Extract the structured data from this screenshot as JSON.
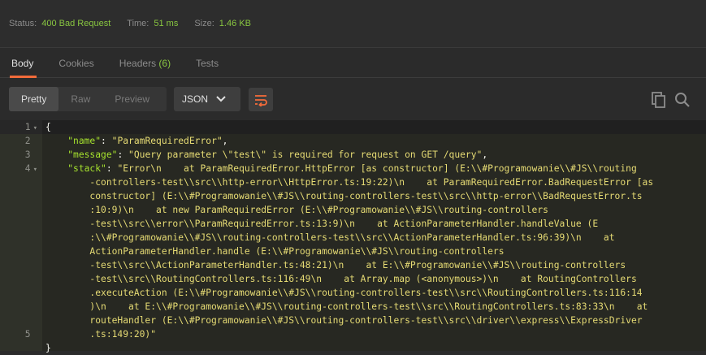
{
  "status": {
    "status_label": "Status:",
    "status_value": "400 Bad Request",
    "time_label": "Time:",
    "time_value": "51 ms",
    "size_label": "Size:",
    "size_value": "1.46 KB"
  },
  "tabs": {
    "body": "Body",
    "cookies": "Cookies",
    "headers": "Headers",
    "headers_count": "(6)",
    "tests": "Tests"
  },
  "toolbar": {
    "pretty": "Pretty",
    "raw": "Raw",
    "preview": "Preview",
    "format": "JSON"
  },
  "editor": {
    "line_numbers": [
      "1",
      "2",
      "3",
      "4",
      "",
      "",
      "",
      "",
      "",
      "",
      "",
      "",
      "",
      "",
      "",
      "5"
    ],
    "lines": [
      {
        "parts": [
          {
            "t": "{",
            "c": "plain"
          }
        ]
      },
      {
        "parts": [
          {
            "t": "    ",
            "c": "plain"
          },
          {
            "t": "\"name\"",
            "c": "key"
          },
          {
            "t": ": ",
            "c": "plain"
          },
          {
            "t": "\"ParamRequiredError\"",
            "c": "str"
          },
          {
            "t": ",",
            "c": "plain"
          }
        ]
      },
      {
        "parts": [
          {
            "t": "    ",
            "c": "plain"
          },
          {
            "t": "\"message\"",
            "c": "key"
          },
          {
            "t": ": ",
            "c": "plain"
          },
          {
            "t": "\"Query parameter \\\"test\\\" is required for request on GET /query\"",
            "c": "str"
          },
          {
            "t": ",",
            "c": "plain"
          }
        ]
      },
      {
        "parts": [
          {
            "t": "    ",
            "c": "plain"
          },
          {
            "t": "\"stack\"",
            "c": "key"
          },
          {
            "t": ": ",
            "c": "plain"
          },
          {
            "t": "\"Error\\n    at ParamRequiredError.HttpError [as constructor] (E:\\\\#Programowanie\\\\#JS\\\\routing",
            "c": "str"
          }
        ]
      },
      {
        "parts": [
          {
            "t": "        -controllers-test\\\\src\\\\http-error\\\\HttpError.ts:19:22)\\n    at ParamRequiredError.BadRequestError [as",
            "c": "str"
          }
        ]
      },
      {
        "parts": [
          {
            "t": "        constructor] (E:\\\\#Programowanie\\\\#JS\\\\routing-controllers-test\\\\src\\\\http-error\\\\BadRequestError.ts",
            "c": "str"
          }
        ]
      },
      {
        "parts": [
          {
            "t": "        :10:9)\\n    at new ParamRequiredError (E:\\\\#Programowanie\\\\#JS\\\\routing-controllers",
            "c": "str"
          }
        ]
      },
      {
        "parts": [
          {
            "t": "        -test\\\\src\\\\error\\\\ParamRequiredError.ts:13:9)\\n    at ActionParameterHandler.handleValue (E",
            "c": "str"
          }
        ]
      },
      {
        "parts": [
          {
            "t": "        :\\\\#Programowanie\\\\#JS\\\\routing-controllers-test\\\\src\\\\ActionParameterHandler.ts:96:39)\\n    at",
            "c": "str"
          }
        ]
      },
      {
        "parts": [
          {
            "t": "        ActionParameterHandler.handle (E:\\\\#Programowanie\\\\#JS\\\\routing-controllers",
            "c": "str"
          }
        ]
      },
      {
        "parts": [
          {
            "t": "        -test\\\\src\\\\ActionParameterHandler.ts:48:21)\\n    at E:\\\\#Programowanie\\\\#JS\\\\routing-controllers",
            "c": "str"
          }
        ]
      },
      {
        "parts": [
          {
            "t": "        -test\\\\src\\\\RoutingControllers.ts:116:49\\n    at Array.map (<anonymous>)\\n    at RoutingControllers",
            "c": "str"
          }
        ]
      },
      {
        "parts": [
          {
            "t": "        .executeAction (E:\\\\#Programowanie\\\\#JS\\\\routing-controllers-test\\\\src\\\\RoutingControllers.ts:116:14",
            "c": "str"
          }
        ]
      },
      {
        "parts": [
          {
            "t": "        )\\n    at E:\\\\#Programowanie\\\\#JS\\\\routing-controllers-test\\\\src\\\\RoutingControllers.ts:83:33\\n    at",
            "c": "str"
          }
        ]
      },
      {
        "parts": [
          {
            "t": "        routeHandler (E:\\\\#Programowanie\\\\#JS\\\\routing-controllers-test\\\\src\\\\driver\\\\express\\\\ExpressDriver",
            "c": "str"
          }
        ]
      },
      {
        "parts": [
          {
            "t": "        .ts:149:20)\"",
            "c": "str"
          }
        ]
      },
      {
        "parts": [
          {
            "t": "}",
            "c": "plain"
          }
        ]
      }
    ]
  },
  "colors": {
    "accent": "#f26b3a",
    "status_green": "#88c540",
    "json_key": "#a6e22e",
    "json_string": "#e6db74"
  }
}
